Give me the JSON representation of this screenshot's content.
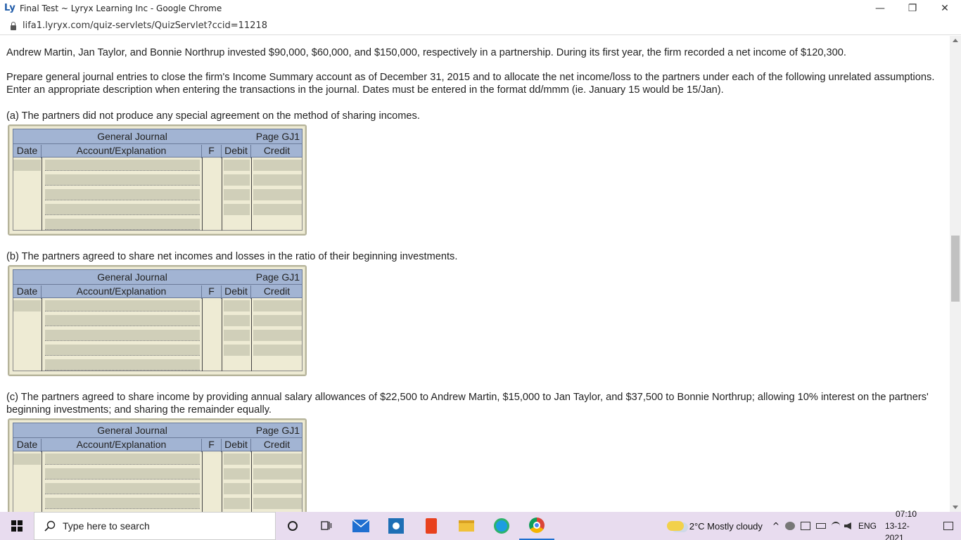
{
  "window": {
    "title": "Final Test ~ Lyryx Learning Inc - Google Chrome",
    "favicon_text": "Ly",
    "minimize": "—",
    "restore": "❐",
    "close": "✕"
  },
  "address": {
    "url": "lifa1.lyryx.com/quiz-servlets/QuizServlet?ccid=11218"
  },
  "question": {
    "intro": "Andrew Martin, Jan Taylor, and Bonnie Northrup invested $90,000, $60,000, and $150,000, respectively in a partnership. During its first year, the firm recorded a net income of $120,300.",
    "instructions": "Prepare general journal entries to close the firm's Income Summary account as of December 31, 2015 and to allocate the net income/loss to the partners under each of the following unrelated assumptions. Enter an appropriate description when entering the transactions in the journal. Dates must be entered in the format dd/mmm (ie. January 15 would be 15/Jan).",
    "part_a": "(a) The partners did not produce any special agreement on the method of sharing incomes.",
    "part_b": "(b) The partners agreed to share net incomes and losses in the ratio of their beginning investments.",
    "part_c": "(c) The partners agreed to share income by providing annual salary allowances of $22,500 to Andrew Martin, $15,000 to Jan Taylor, and $37,500 to Bonnie Northrup; allowing 10% interest on the partners' beginning investments; and sharing the remainder equally."
  },
  "journal": {
    "title": "General Journal",
    "page": "Page GJ1",
    "columns": {
      "date": "Date",
      "account": "Account/Explanation",
      "f": "F",
      "debit": "Debit",
      "credit": "Credit"
    }
  },
  "taskbar": {
    "search_placeholder": "Type here to search",
    "weather": "2°C  Mostly cloudy",
    "language": "ENG",
    "time": "07:10",
    "date": "13-12-2021"
  },
  "colors": {
    "journal_header": "#a2b4d3",
    "journal_body": "#eeebd4",
    "input_cell": "#d0cfb9",
    "taskbar": "#e8dcef"
  }
}
